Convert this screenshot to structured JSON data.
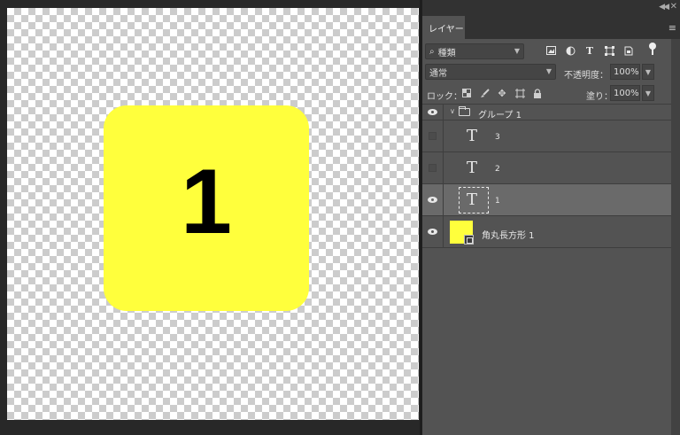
{
  "canvas": {
    "artwork_number": "1",
    "artwork_color": "#ffff3c"
  },
  "panel": {
    "tab_label": "レイヤー",
    "menu_icon": "panel-menu-icon",
    "filter": {
      "label": "種類",
      "icons": [
        "image-filter-icon",
        "adjustment-filter-icon",
        "text-filter-icon",
        "shape-filter-icon",
        "smart-object-filter-icon"
      ]
    },
    "blend": {
      "mode": "通常",
      "opacity_label": "不透明度：",
      "opacity_value": "100%"
    },
    "lock": {
      "label": "ロック：",
      "icons": [
        "lock-transparent-icon",
        "lock-paint-icon",
        "lock-position-icon",
        "lock-artboard-icon",
        "lock-all-icon"
      ],
      "fill_label": "塗り：",
      "fill_value": "100%"
    },
    "layers": [
      {
        "name": "グループ 1",
        "type": "group",
        "visible": true
      },
      {
        "name": "3",
        "type": "text",
        "visible": false
      },
      {
        "name": "2",
        "type": "text",
        "visible": false
      },
      {
        "name": "1",
        "type": "text",
        "visible": true,
        "selected": true
      },
      {
        "name": "角丸長方形 1",
        "type": "shape",
        "visible": true
      }
    ]
  }
}
